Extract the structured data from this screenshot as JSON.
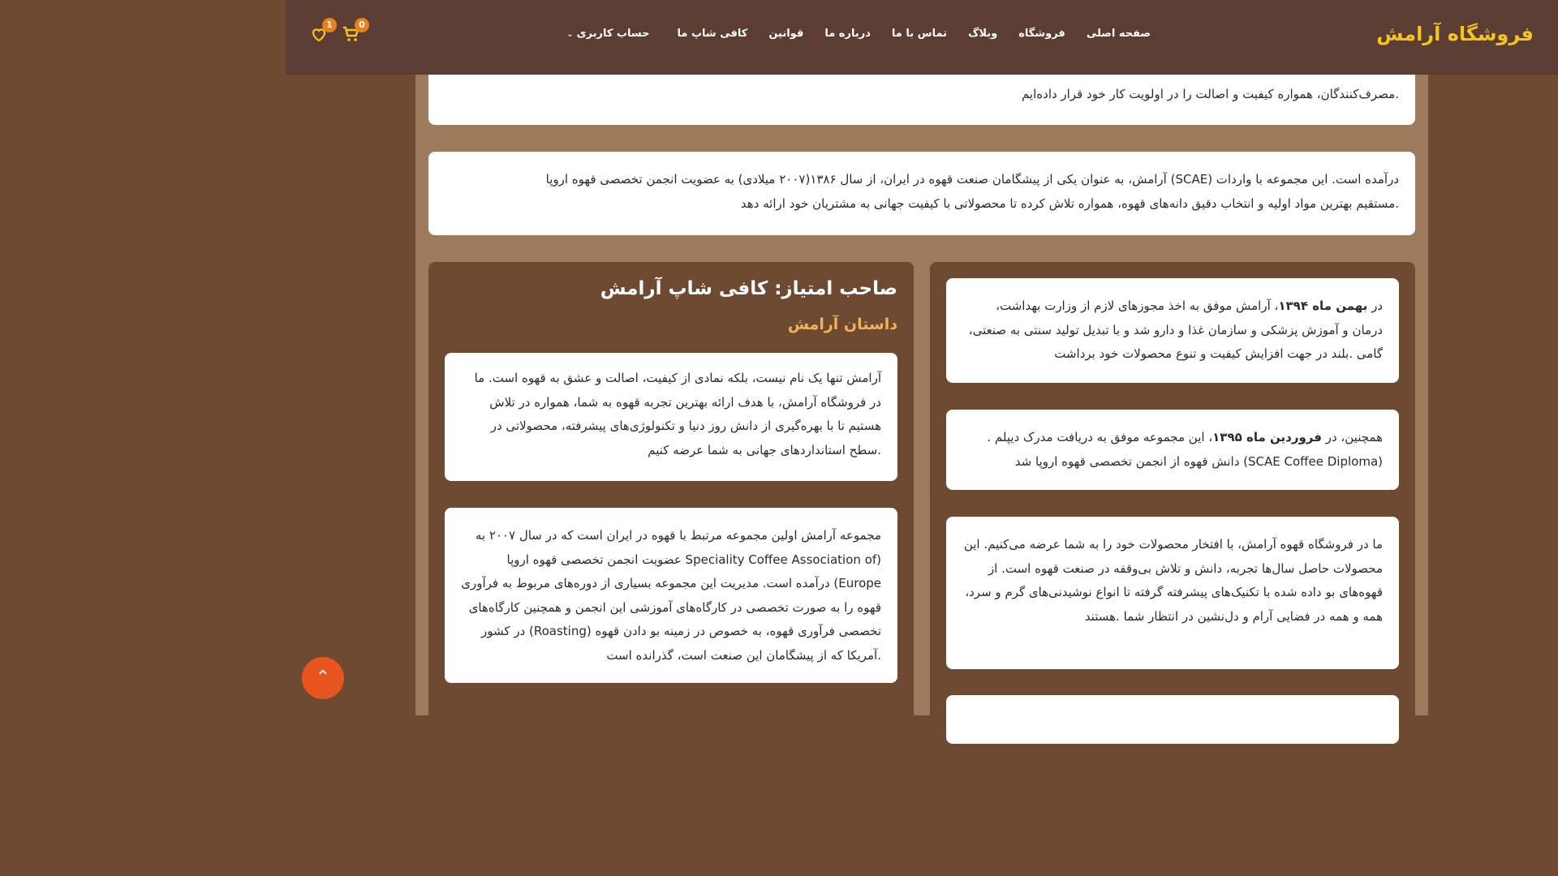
{
  "header": {
    "brand": "فروشگاه آرامش",
    "nav": [
      "صفحه اصلی",
      "فروشگاه",
      "وبلاگ",
      "تماس با ما",
      "درباره ما",
      "قوانین",
      "کافی شاپ ما",
      "حساب کاربری"
    ],
    "cart_count": "0",
    "wishlist_count": "1",
    "icons": [
      "cart-icon",
      "heart-icon",
      "chevron-down-icon",
      "double-chevron-up-icon"
    ],
    "accent_color": "#f6c21c"
  },
  "top_card": {
    "line2": ".مصرف‌کنندگان، همواره کیفیت و اصالت را در اولویت کار خود قرار داده‌ایم"
  },
  "intro_card": {
    "line1": "درآمده است. این مجموعه با واردات (SCAE) آرامش، به عنوان یکی از پیشگامان صنعت قهوه در ایران، از سال ۱۳۸۶(۲۰۰۷ میلادی) به عضویت انجمن تخصصی قهوه اروپا",
    "line2": ".مستقیم بهترین مواد اولیه و انتخاب دقیق دانه‌های قهوه، همواره تلاش کرده تا محصولاتی با کیفیت جهانی به مشتریان خود ارائه دهد"
  },
  "left_panel": {
    "title": "صاحب امتیاز: کافی شاپ آرامش",
    "subtitle": "داستان آرامش",
    "card1": "آرامش تنها یک نام نیست، بلکه نمادی از کیفیت، اصالت و عشق به قهوه است. ما در فروشگاه آرامش، با هدف ارائه بهترین تجربه قهوه به شما، همواره در تلاش هستیم تا با بهره‌گیری از دانش روز دنیا و تکنولوژی‌های پیشرفته، محصولاتی در .سطح استانداردهای جهانی به شما عرضه کنیم",
    "card2": "مجموعه آرامش اولین مجموعه مرتبط با قهوه در ایران است که در سال ۲۰۰۷ به (Speciality Coffee Association of عضویت انجمن تخصصی قهوه اروپا Europe) درآمده است. مدیریت این مجموعه بسیاری از دوره‌های مربوط به فرآوری قهوه را به صورت تخصصی در کارگاه‌های آموزشی این انجمن و همچنین کارگاه‌های تخصصی فرآوری قهوه، به خصوص در زمینه بو دادن قهوه (Roasting) در کشور .آمریکا که از پیشگامان این صنعت است، گذرانده است"
  },
  "right_panel": {
    "card1_pre": "در ",
    "card1_bold": "بهمن ماه ۱۳۹۴",
    "card1_post": "، آرامش موفق به اخذ مجوزهای لازم از وزارت بهداشت، درمان و آموزش پزشکی و سازمان غذا و دارو شد و با تبدیل تولید سنتی به صنعتی، گامی .بلند در جهت افزایش کیفیت و تنوع محصولات خود برداشت",
    "card2_pre": "همچنین، در ",
    "card2_bold": "فروردین ماه ۱۳۹۵",
    "card2_post": "، این مجموعه موفق به دریافت مدرک دیپلم .(SCAE Coffee Diploma) دانش قهوه از انجمن تخصصی قهوه اروپا شد",
    "card3": "ما در فروشگاه قهوه آرامش، با افتخار محصولات خود را به شما عرضه می‌کنیم. این محصولات حاصل سال‌ها تجربه، دانش و تلاش بی‌وقفه در صنعت قهوه است. از قهوه‌های بو داده شده با تکنیک‌های پیشرفته گرفته تا انواع نوشیدنی‌های گرم و سرد، همه و همه در فضایی آرام و دل‌نشین در انتظار شما .هستند"
  }
}
